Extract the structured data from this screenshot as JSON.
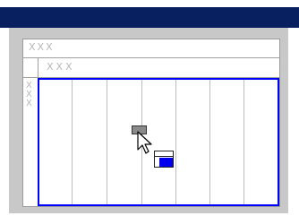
{
  "headers": {
    "column_header_row_1": "XXX",
    "column_header_row_2": "XXX",
    "row_header": "XXX"
  },
  "colors": {
    "titlebar": "#082060",
    "window_background": "#c8c8c8",
    "selection_border": "#0000ff",
    "drop_indicator_fill": "#0000ee",
    "dragged_cell": "#8a8a8a"
  },
  "icons": {
    "pointer": "arrow-pointer-icon",
    "dragged_cell": "drag-cell-icon",
    "drop_target": "drop-target-icon"
  }
}
